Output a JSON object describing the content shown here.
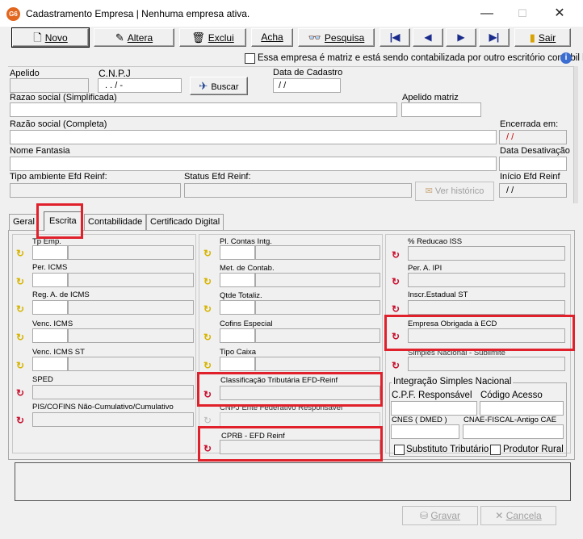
{
  "window": {
    "title": "Cadastramento Empresa | Nenhuma empresa ativa.",
    "app_icon": "G6",
    "minimize": "—",
    "maximize": "☐",
    "close": "✕"
  },
  "toolbar": {
    "novo": "Novo",
    "altera": "Altera",
    "exclui": "Exclui",
    "acha": "Acha",
    "pesquisa": "Pesquisa",
    "first": "|◀",
    "prev": "◀",
    "next": "▶",
    "last": "▶|",
    "sair": "Sair"
  },
  "matriz_label": "Essa empresa é matriz e está sendo contabilizada por outro escritório contábil l",
  "fields": {
    "apelido": "Apelido",
    "cnpj": "C.N.P.J",
    "cnpj_value": ". . / -",
    "buscar": "Buscar",
    "data_cadastro": "Data de Cadastro",
    "data_cadastro_value": "/ /",
    "razao_simpl": "Razao social (Simplificada)",
    "apelido_matriz": "Apelido matriz",
    "razao_completa": "Razão social (Completa)",
    "encerrada": "Encerrada em:",
    "encerrada_value": "/ /",
    "nome_fantasia": "Nome Fantasia",
    "data_desativacao": "Data Desativação",
    "tipo_ambiente": "Tipo ambiente Efd Reinf:",
    "status_efd": "Status Efd Reinf:",
    "ver_historico": "Ver histórico",
    "inicio_efd": "Início Efd Reinf",
    "inicio_efd_value": "/ /"
  },
  "tabs": [
    "Geral",
    "Escrita",
    "Contabilidade",
    "Certificado Digital"
  ],
  "col1": [
    "Tp Emp.",
    "Per. ICMS",
    "Reg. A. de ICMS",
    "Venc. ICMS",
    "Venc. ICMS ST",
    "SPED",
    "PIS/COFINS Não-Cumulativo/Cumulativo"
  ],
  "col2": [
    "Pl. Contas Intg.",
    "Met. de Contab.",
    "Qtde Totaliz.",
    "Cofins Especial",
    "Tipo Caixa",
    "Classificação Tributária EFD-Reinf",
    "CNPJ Ente Federativo Responsável",
    "CPRB - EFD Reinf"
  ],
  "col3": [
    "% Reducao ISS",
    "Per. A. IPI",
    "Inscr.Estadual ST",
    "Empresa Obrigada à ECD",
    "Simples Nacional - Sublimite"
  ],
  "simples": {
    "group": "Integração Simples Nacional",
    "cpf": "C.P.F. Responsável",
    "codigo": "Código Acesso",
    "cnes": "CNES ( DMED )",
    "cnae": "CNAE-FISCAL-Antigo CAE",
    "substituto": "Substituto Tributário",
    "produtor": "Produtor Rural"
  },
  "bottom": {
    "gravar": "Gravar",
    "cancela": "Cancela"
  }
}
